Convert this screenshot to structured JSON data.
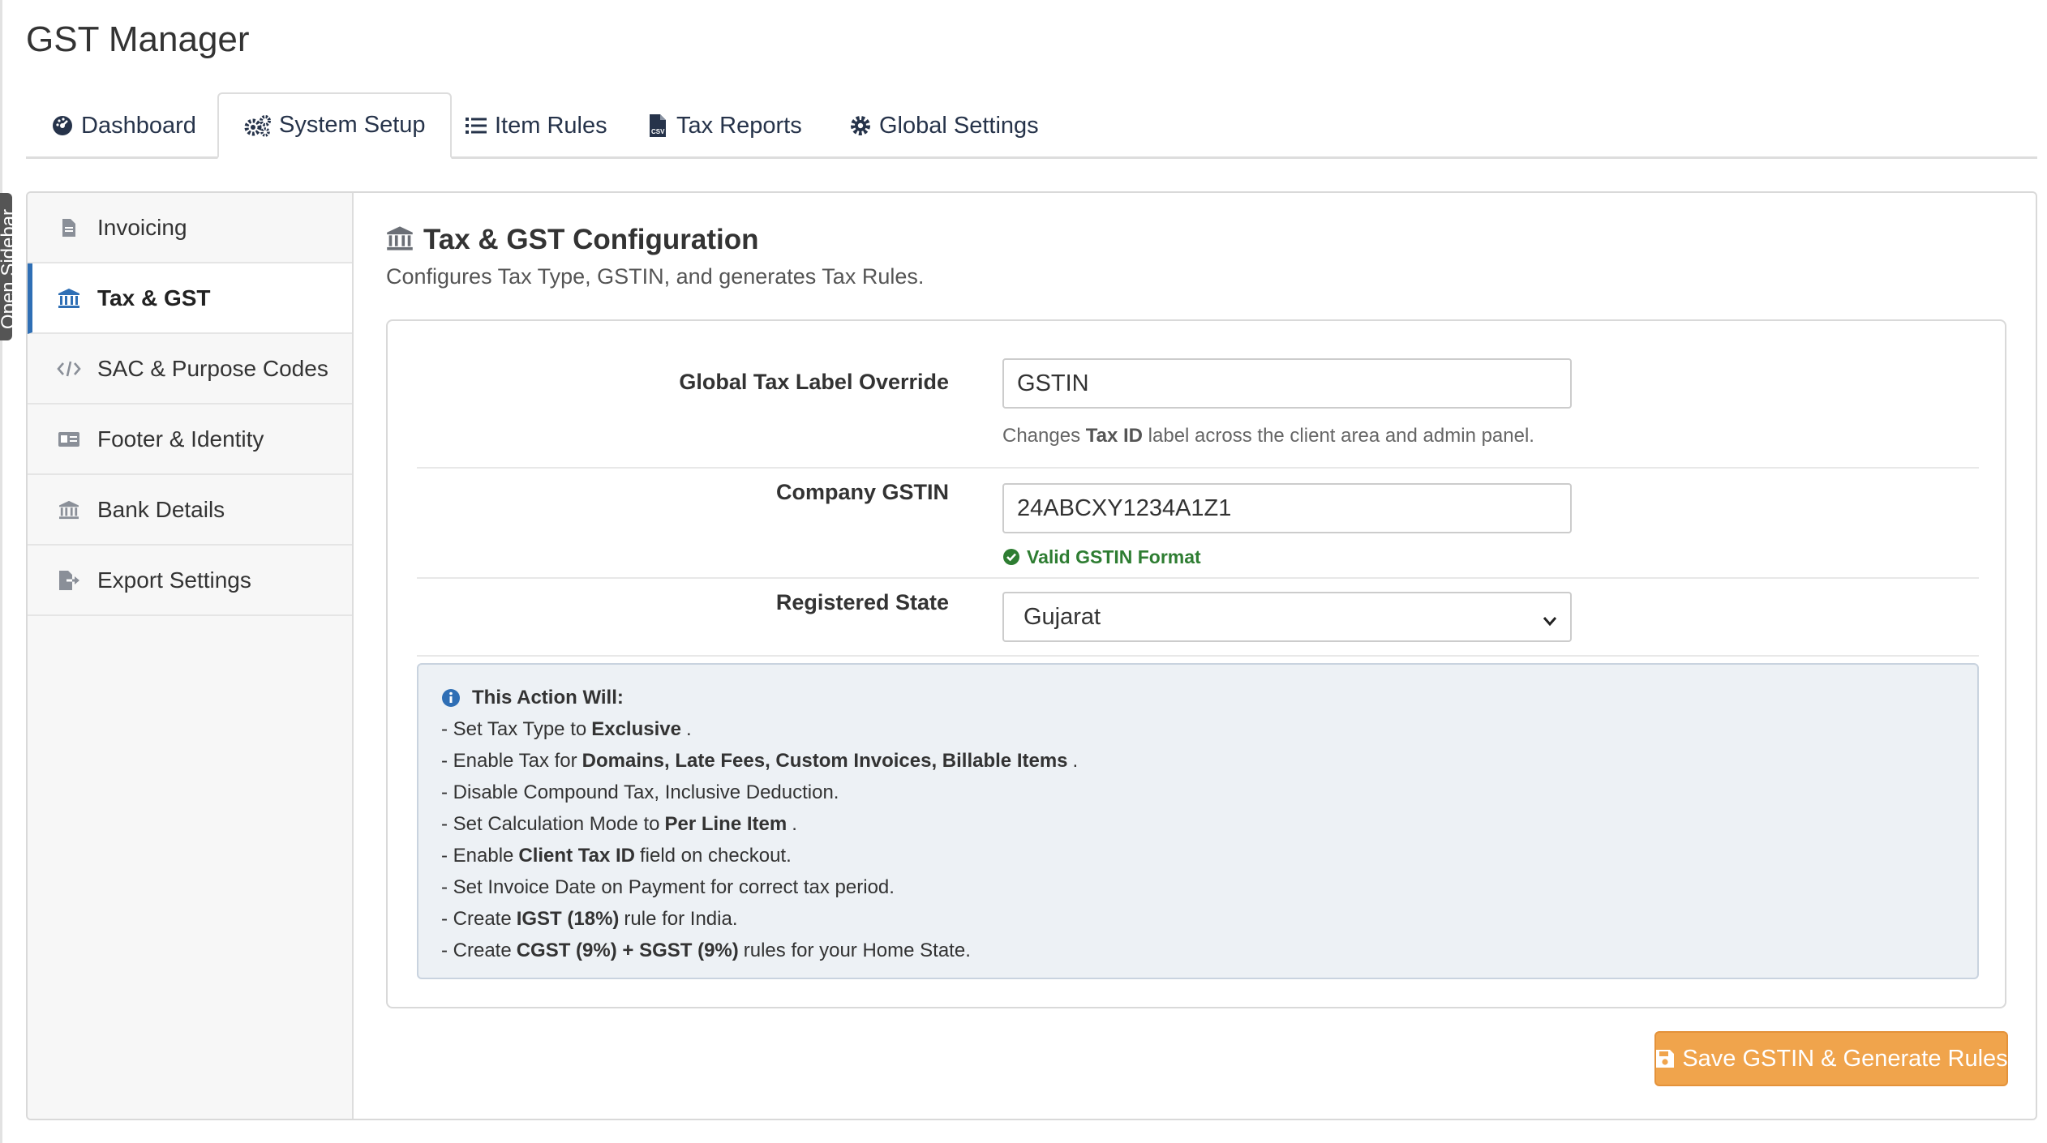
{
  "app": {
    "title": "GST Manager",
    "sidebar_toggle": "Open Sidebar"
  },
  "tabs": [
    {
      "label": "Dashboard",
      "icon": "dashboard-icon",
      "active": false
    },
    {
      "label": "System Setup",
      "icon": "cogs-icon",
      "active": true
    },
    {
      "label": "Item Rules",
      "icon": "list-icon",
      "active": false
    },
    {
      "label": "Tax Reports",
      "icon": "csv-file-icon",
      "active": false
    },
    {
      "label": "Global Settings",
      "icon": "gear-icon",
      "active": false
    }
  ],
  "side": {
    "items": [
      {
        "label": "Invoicing",
        "icon": "file-icon",
        "active": false
      },
      {
        "label": "Tax & GST",
        "icon": "bank-icon",
        "active": true
      },
      {
        "label": "SAC & Purpose Codes",
        "icon": "code-icon",
        "active": false
      },
      {
        "label": "Footer & Identity",
        "icon": "id-card-icon",
        "active": false
      },
      {
        "label": "Bank Details",
        "icon": "bank-icon",
        "active": false
      },
      {
        "label": "Export Settings",
        "icon": "file-export-icon",
        "active": false
      }
    ]
  },
  "section": {
    "title": "Tax & GST Configuration",
    "subtitle": "Configures Tax Type, GSTIN, and generates Tax Rules."
  },
  "form": {
    "tax_label": {
      "label": "Global Tax Label Override",
      "value": "GSTIN",
      "help_prefix": "Changes",
      "help_bold": "Tax ID",
      "help_suffix": "label across the client area and admin panel."
    },
    "gstin": {
      "label": "Company GSTIN",
      "value": "24ABCXY1234A1Z1",
      "status": "Valid GSTIN Format"
    },
    "state": {
      "label": "Registered State",
      "value": "Gujarat"
    }
  },
  "info": {
    "heading": "This Action Will:",
    "lines": [
      {
        "pre": "- Set Tax Type to",
        "bold": "Exclusive",
        "post": "."
      },
      {
        "pre": "- Enable Tax for",
        "bold": "Domains, Late Fees, Custom Invoices, Billable Items",
        "post": "."
      },
      {
        "pre": "- Disable Compound Tax, Inclusive Deduction.",
        "bold": "",
        "post": ""
      },
      {
        "pre": "- Set Calculation Mode to",
        "bold": "Per Line Item",
        "post": "."
      },
      {
        "pre": "- Enable",
        "bold": "Client Tax ID",
        "post": "field on checkout."
      },
      {
        "pre": "- Set Invoice Date on Payment for correct tax period.",
        "bold": "",
        "post": ""
      },
      {
        "pre": "- Create",
        "bold": "IGST (18%)",
        "post": "rule for India."
      },
      {
        "pre": "- Create",
        "bold": "CGST (9%) + SGST (9%)",
        "post": "rules for your Home State."
      }
    ]
  },
  "actions": {
    "save_label": "Save GSTIN & Generate Rules"
  },
  "colors": {
    "accent_orange": "#f0a44c",
    "active_blue": "#2f6fb5",
    "valid_green": "#2e7d32"
  }
}
